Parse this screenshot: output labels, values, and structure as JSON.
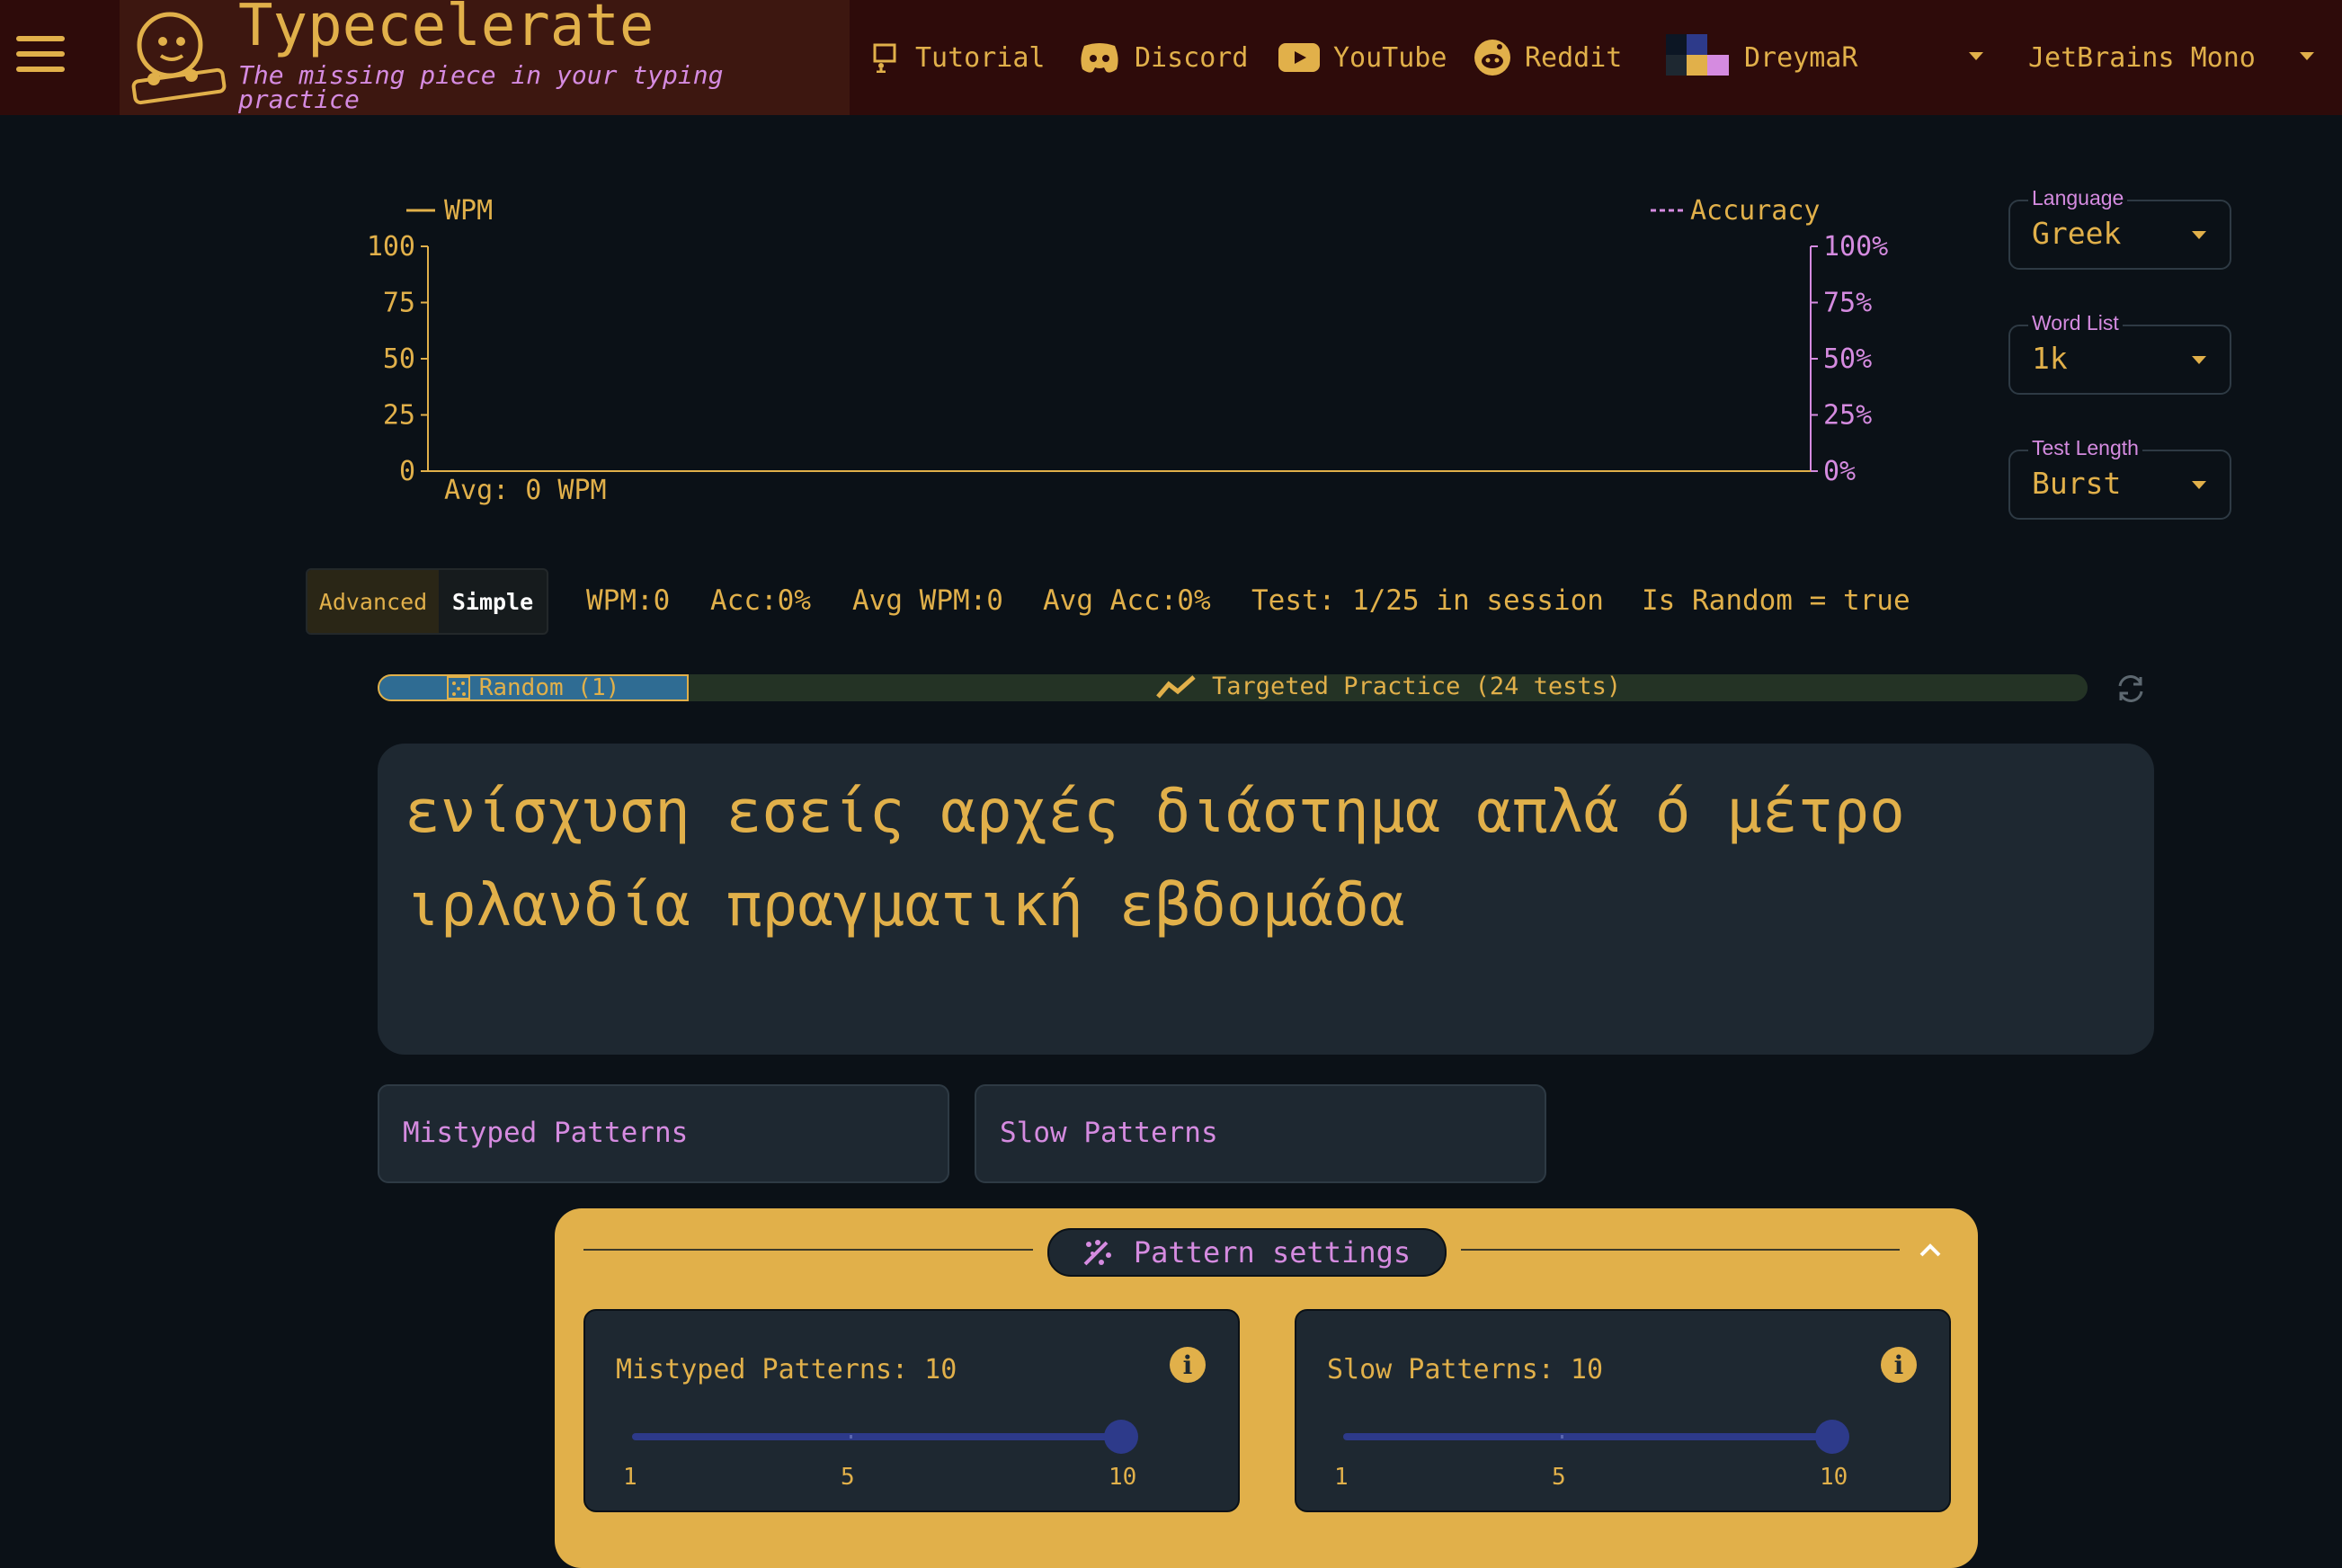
{
  "colors": {
    "accent": "#e1b04a",
    "pink": "#d58be0",
    "header": "#2e0b0a",
    "bg": "#0b1117",
    "card": "#1e2831",
    "slider": "#2d3a8a"
  },
  "header": {
    "brand_title": "Typecelerate",
    "brand_subtitle": "The missing piece in your typing practice",
    "nav": {
      "tutorial": "Tutorial",
      "discord": "Discord",
      "youtube": "YouTube",
      "reddit": "Reddit"
    },
    "theme": "DreymaR",
    "font": "JetBrains Mono"
  },
  "chart_data": {
    "type": "line",
    "series": [
      {
        "name": "WPM",
        "values": []
      },
      {
        "name": "Accuracy",
        "values": []
      }
    ],
    "left_ticks": [
      "100",
      "75",
      "50",
      "25",
      "0"
    ],
    "right_ticks": [
      "100%",
      "75%",
      "50%",
      "25%",
      "0%"
    ],
    "ylim": [
      0,
      100
    ],
    "y2lim": [
      0,
      100
    ],
    "avg_label": "Avg: 0 WPM",
    "legend_placement": "top"
  },
  "settings": {
    "language": {
      "label": "Language",
      "value": "Greek"
    },
    "word_list": {
      "label": "Word List",
      "value": "1k"
    },
    "test_length": {
      "label": "Test Length",
      "value": "Burst"
    }
  },
  "mode": {
    "advanced": "Advanced",
    "simple": "Simple"
  },
  "stats": {
    "wpm": "WPM:0",
    "acc": "Acc:0%",
    "avg_wpm": "Avg WPM:0",
    "avg_acc": "Avg Acc:0%",
    "test": "Test: 1/25 in session",
    "random": "Is Random = true"
  },
  "progress": {
    "random": "Random (1)",
    "targeted": "Targeted Practice (24 tests)",
    "random_fraction": 0.18
  },
  "typing": {
    "text": "ενίσχυση εσείς αρχές διάστημα απλά ό μέτρο ιρλανδία πραγματική εβδομάδα"
  },
  "patterns": {
    "mistyped": "Mistyped Patterns",
    "slow": "Slow Patterns"
  },
  "pattern_settings": {
    "title": "Pattern settings",
    "mistyped": {
      "label": "Mistyped Patterns: 10",
      "value": 10,
      "min": 1,
      "max": 10,
      "ticks": [
        "1",
        "5",
        "10"
      ]
    },
    "slow": {
      "label": "Slow Patterns: 10",
      "value": 10,
      "min": 1,
      "max": 10,
      "ticks": [
        "1",
        "5",
        "10"
      ]
    }
  }
}
